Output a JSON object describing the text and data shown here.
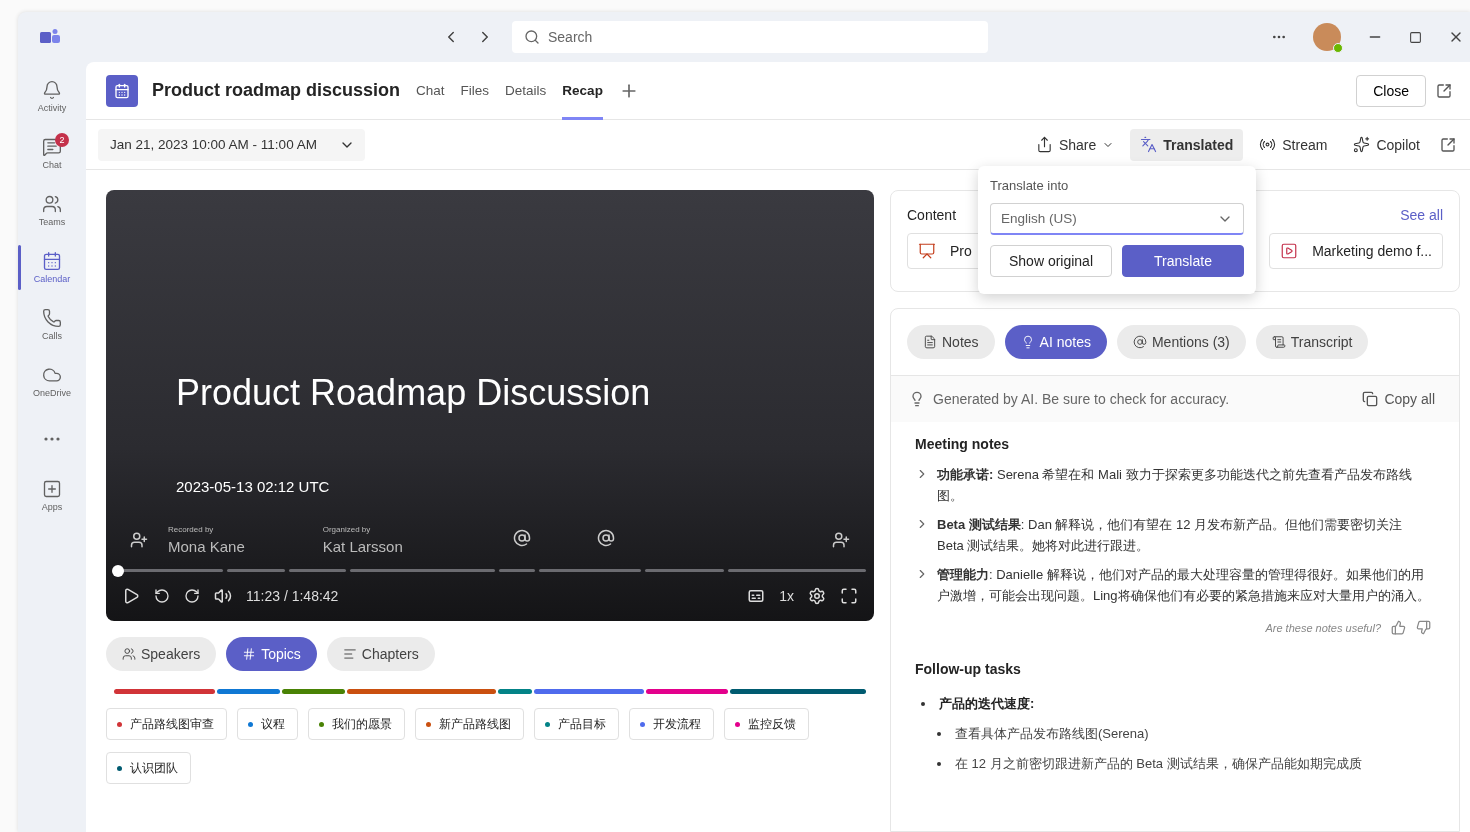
{
  "titlebar": {
    "search_placeholder": "Search"
  },
  "rail": [
    {
      "kind": "activity",
      "label": "Activity",
      "selected": false
    },
    {
      "kind": "chat",
      "label": "Chat",
      "badge": "2",
      "selected": false
    },
    {
      "kind": "teams",
      "label": "Teams",
      "selected": false
    },
    {
      "kind": "calendar",
      "label": "Calendar",
      "selected": true
    },
    {
      "kind": "calls",
      "label": "Calls",
      "selected": false
    },
    {
      "kind": "onedrive",
      "label": "OneDrive",
      "selected": false
    },
    {
      "kind": "more",
      "selected": false
    },
    {
      "kind": "apps",
      "label": "Apps",
      "selected": false
    }
  ],
  "meeting": {
    "title": "Product roadmap discussion",
    "close": "Close",
    "tabs": [
      {
        "label": "Chat",
        "selected": false
      },
      {
        "label": "Files",
        "selected": false
      },
      {
        "label": "Details",
        "selected": false
      },
      {
        "label": "Recap",
        "selected": true
      }
    ]
  },
  "date_range": "Jan 21, 2023 10:00 AM - 11:00 AM",
  "actions": [
    {
      "kind": "share",
      "label": "Share",
      "selected": false
    },
    {
      "kind": "translate",
      "label": "Translated",
      "selected": true
    },
    {
      "kind": "stream",
      "label": "Stream",
      "selected": false
    },
    {
      "kind": "copilot",
      "label": "Copilot",
      "selected": false
    }
  ],
  "translate_popup": {
    "title": "Translate into",
    "value": "English (US)",
    "secondary": "Show original",
    "primary": "Translate"
  },
  "video": {
    "slide_title": "Product Roadmap Discussion",
    "slide_date": "2023-05-13 02:12 UTC",
    "recorded_label": "Recorded by",
    "recorded_name": "Mona Kane",
    "organized_label": "Organized by",
    "organized_name": "Kat Larsson",
    "time": "11:23 / 1:48:42",
    "speed": "1x",
    "progress": {
      "level": 0
    }
  },
  "views": [
    {
      "kind": "speakers",
      "label": "Speakers",
      "selected": false
    },
    {
      "kind": "topics",
      "label": "Topics",
      "selected": true
    },
    {
      "kind": "chapters",
      "label": "Chapters",
      "selected": false
    }
  ],
  "topics": [
    {
      "label": "产品路线图审查",
      "color": "#d13438"
    },
    {
      "label": "议程",
      "color": "#0f78d4"
    },
    {
      "label": "我们的愿景",
      "color": "#498205"
    },
    {
      "label": "新产品路线图",
      "color": "#ca5010"
    },
    {
      "label": "产品目标",
      "color": "#038387"
    },
    {
      "label": "开发流程",
      "color": "#4f6bed"
    },
    {
      "label": "监控反馈",
      "color": "#e3008c"
    },
    {
      "label": "认识团队",
      "color": "#005b70"
    }
  ],
  "content": {
    "title": "Content",
    "see_all": "See all",
    "files": [
      {
        "kind": "ppt",
        "name": "Pro"
      },
      {
        "kind": "video",
        "name": "Marketing demo f..."
      }
    ]
  },
  "notes_tabs": [
    {
      "kind": "notes",
      "label": "Notes",
      "selected": false
    },
    {
      "kind": "ai",
      "label": "AI notes",
      "selected": true
    },
    {
      "kind": "mentions",
      "label": "Mentions (3)",
      "selected": false
    },
    {
      "kind": "transcript",
      "label": "Transcript",
      "selected": false
    }
  ],
  "disclaimer": "Generated by AI. Be sure to check for accuracy.",
  "copy_all": "Copy all",
  "meeting_notes": {
    "heading": "Meeting notes",
    "items": [
      {
        "text": "**功能承诺:** Serena 希望在和 Mali 致力于探索更多功能迭代之前先查看产品发布路线图。",
        "expanded": false
      },
      {
        "text": "**Beta 测试结果**: Dan 解释说，他们有望在 12 月发布新产品。但他们需要密切关注 Beta 测试结果。她将对此进行跟进。",
        "expanded": false
      },
      {
        "text": "**管理能力**: Danielle 解释说，他们对产品的最大处理容量的管理得很好。如果他们的用户激增，可能会出现问题。Ling将确保他们有必要的紧急措施来应对大量用户的涌入。",
        "expanded": false
      }
    ]
  },
  "feedback": "Are these notes useful?",
  "follow_up": {
    "heading": "Follow-up tasks",
    "items": [
      {
        "text": "产品的迭代速度:",
        "children": [
          {
            "text": "查看具体产品发布路线图(Serena)"
          },
          {
            "text": "在 12 月之前密切跟进新产品的 Beta 测试结果，确保产品能如期完成质"
          }
        ]
      }
    ]
  }
}
